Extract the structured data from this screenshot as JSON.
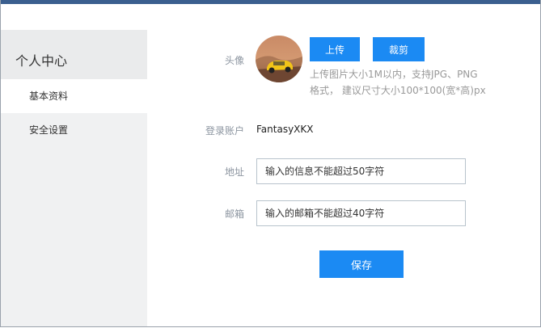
{
  "sidebar": {
    "title": "个人中心",
    "items": [
      {
        "label": "基本资料"
      },
      {
        "label": "安全设置"
      }
    ]
  },
  "form": {
    "avatar_label": "头像",
    "upload_button": "上传",
    "crop_button": "裁剪",
    "hint_line1": "上传图片大小1M以内，支持JPG、PNG",
    "hint_line2": "格式， 建议尺寸大小100*100(宽*高)px",
    "account_label": "登录账户",
    "account_value": "FantasyXKX",
    "address_label": "地址",
    "address_placeholder": "输入的信息不能超过50字符",
    "email_label": "邮箱",
    "email_placeholder": "输入的邮箱不能超过40字符",
    "save_button": "保存"
  },
  "colors": {
    "accent": "#1b8af3",
    "topbar": "#3b5f8f",
    "sidebar_bg": "#f0f1f2",
    "label": "#8c95a0"
  }
}
